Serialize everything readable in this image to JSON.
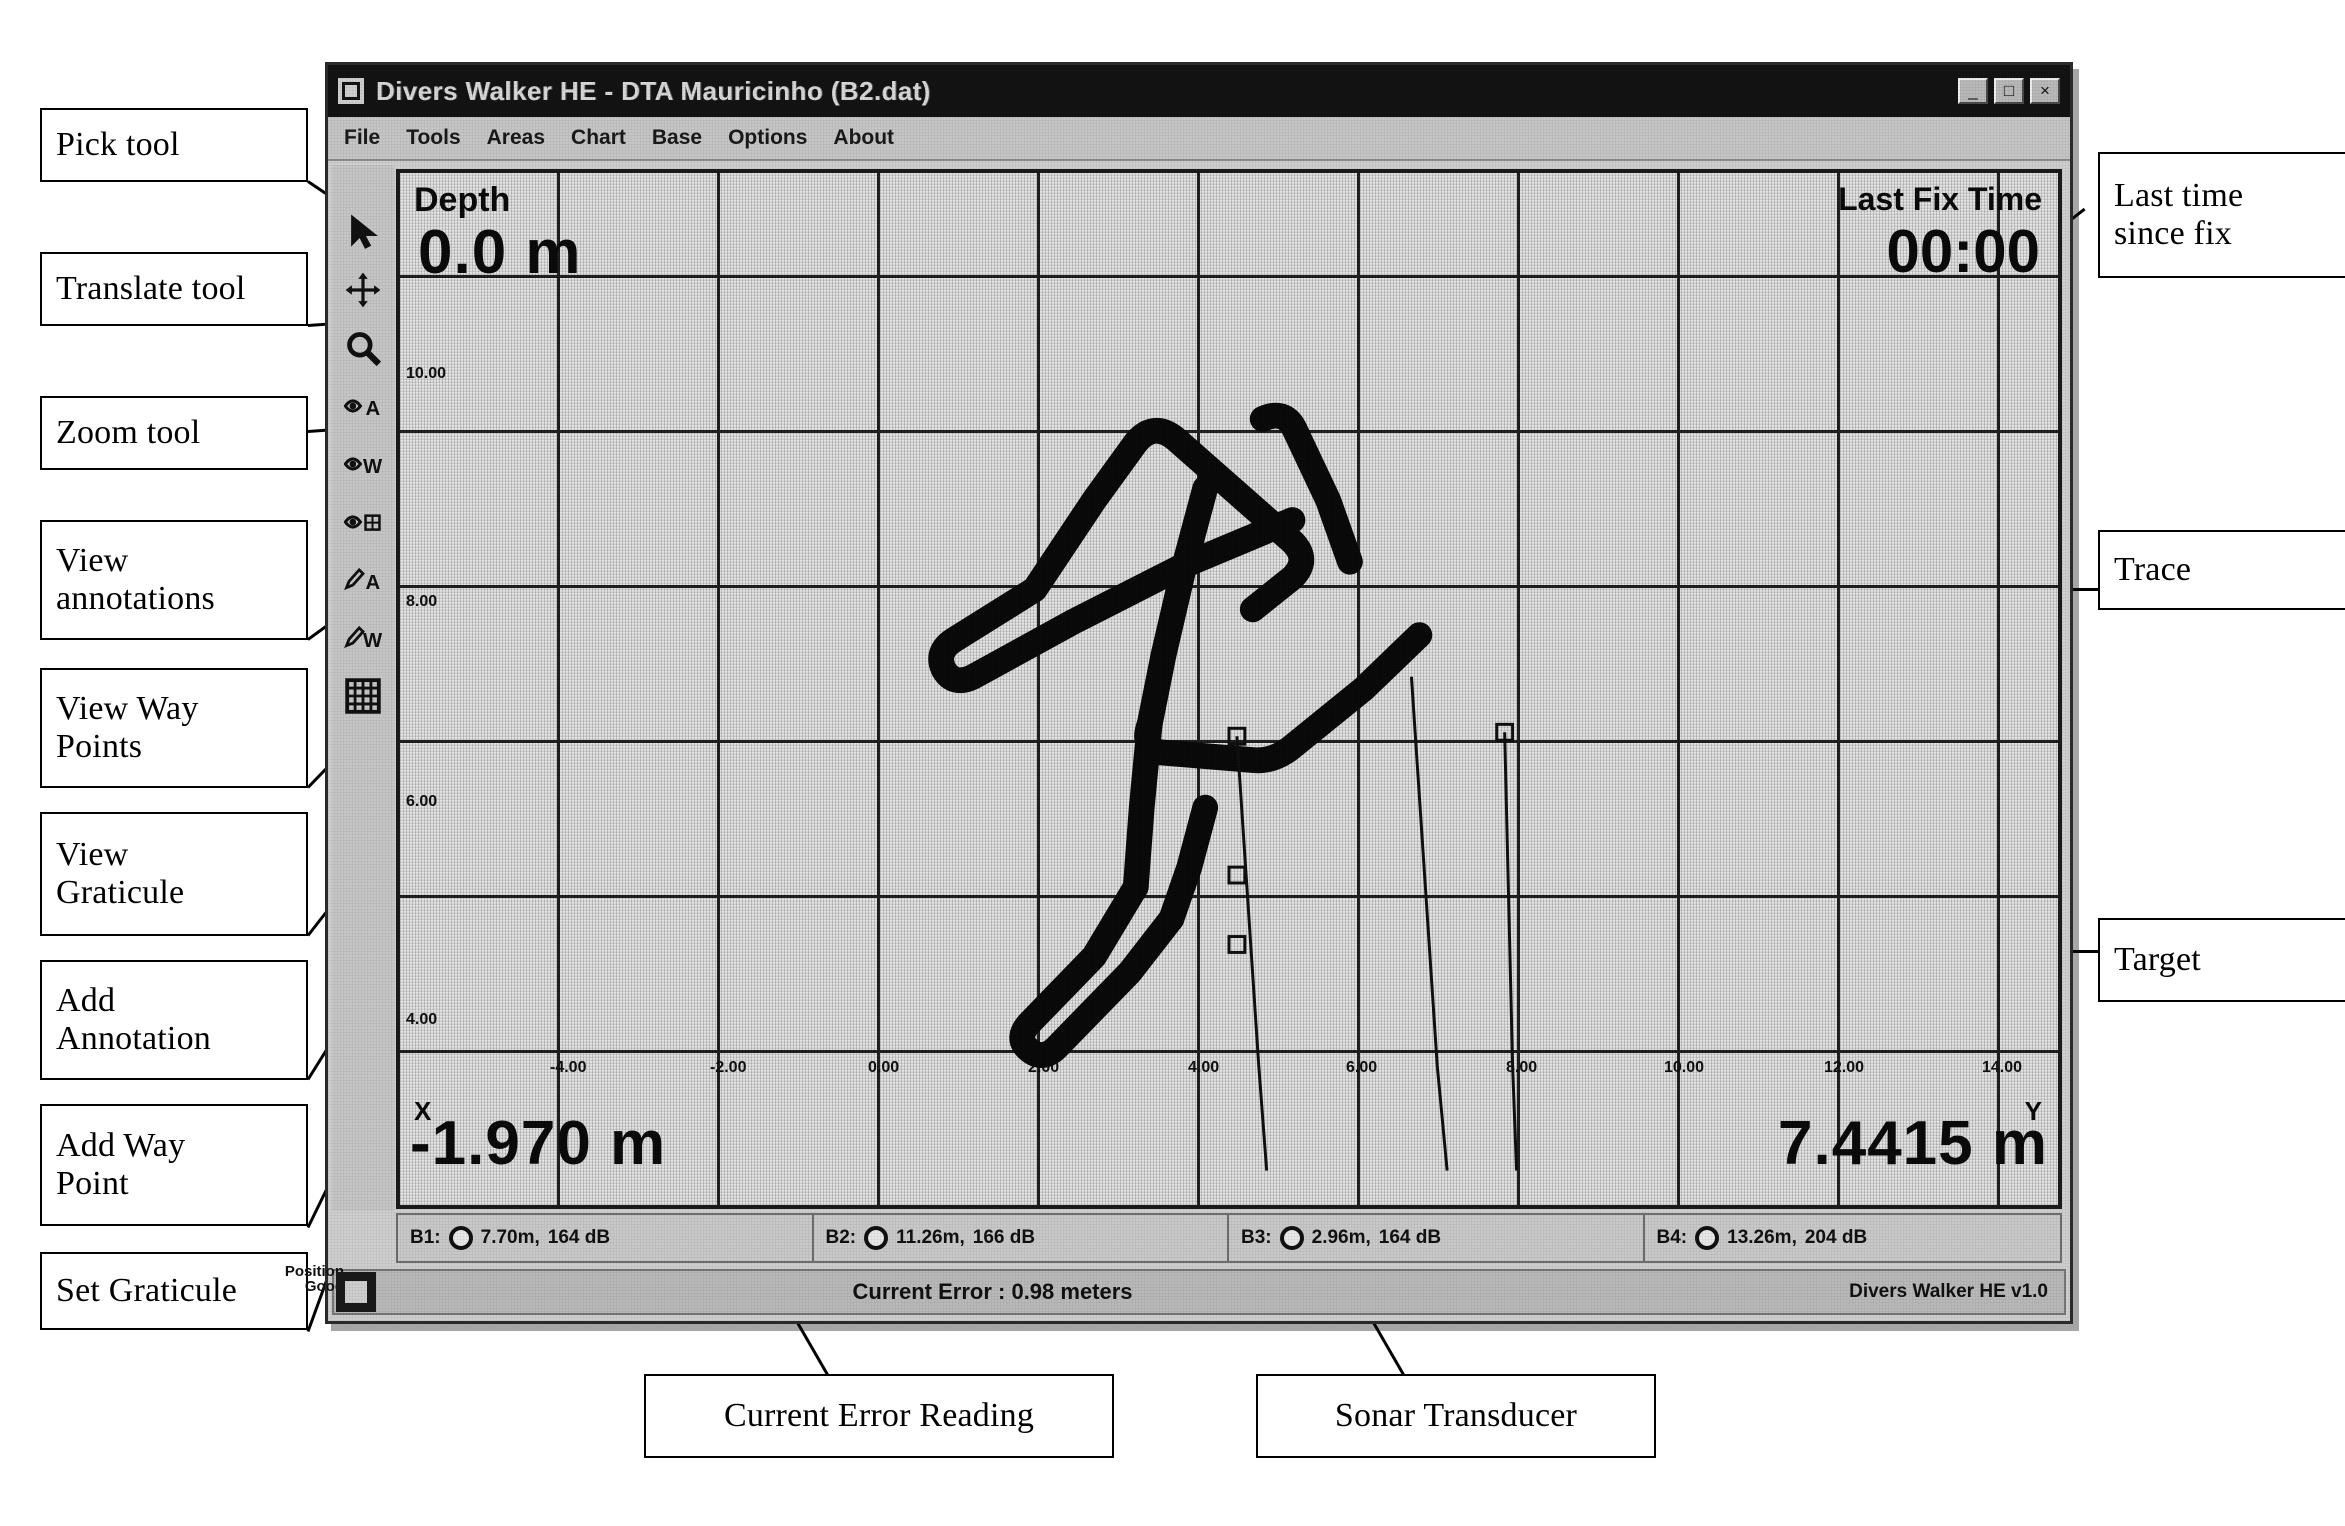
{
  "window": {
    "title": "Divers Walker HE - DTA Mauricinho (B2.dat)",
    "icon": "app-icon",
    "buttons": {
      "minimize": "_",
      "maximize": "□",
      "close": "×"
    }
  },
  "menu": {
    "items": [
      "File",
      "Tools",
      "Areas",
      "Chart",
      "Base",
      "Options",
      "About"
    ]
  },
  "toolbar": {
    "items": [
      {
        "name": "pick-tool",
        "icon": "cursor-arrow-icon",
        "label": "Pick tool"
      },
      {
        "name": "translate-tool",
        "icon": "move-cross-icon",
        "label": "Translate tool"
      },
      {
        "name": "zoom-tool",
        "icon": "magnifier-icon",
        "label": "Zoom tool"
      },
      {
        "name": "view-annotations",
        "icon": "eye-letter-a-icon",
        "label": "View annotations"
      },
      {
        "name": "view-way-points",
        "icon": "eye-letter-w-icon",
        "label": "View Way Points"
      },
      {
        "name": "view-graticule",
        "icon": "eye-grid-icon",
        "label": "View Graticule"
      },
      {
        "name": "add-annotation",
        "icon": "pencil-letter-a-icon",
        "label": "Add Annotation"
      },
      {
        "name": "add-way-point",
        "icon": "pencil-letter-w-icon",
        "label": "Add Way Point"
      },
      {
        "name": "set-graticule",
        "icon": "grid-icon",
        "label": "Set Graticule"
      }
    ]
  },
  "hud": {
    "depth_label": "Depth",
    "depth_value": "0.0 m",
    "last_fix_label": "Last Fix Time",
    "last_fix_value": "00:00",
    "x_label": "X",
    "x_value": "-1.970 m",
    "y_label": "Y",
    "y_value": "7.4415 m"
  },
  "graticule": {
    "y_ticks": [
      "10.00",
      "8.00",
      "6.00",
      "4.00"
    ],
    "x_ticks": [
      "-4.00",
      "-2.00",
      "0.00",
      "2.00",
      "4.00",
      "6.00",
      "8.00",
      "10.00",
      "12.00",
      "14.00"
    ]
  },
  "beacons": [
    {
      "id": "B1:",
      "range": "7.70m,",
      "level": "164 dB"
    },
    {
      "id": "B2:",
      "range": "11.26m,",
      "level": "166 dB"
    },
    {
      "id": "B3:",
      "range": "2.96m,",
      "level": "164 dB"
    },
    {
      "id": "B4:",
      "range": "13.26m,",
      "level": "204 dB"
    }
  ],
  "status": {
    "position_quality": "Position\nGood",
    "led": "status-led",
    "error_text": "Current Error : 0.98 meters",
    "right_text": "Divers Walker  HE  v1.0"
  },
  "callouts": {
    "left": [
      {
        "name": "callout-pick-tool",
        "text": "Pick tool"
      },
      {
        "name": "callout-translate-tool",
        "text": "Translate tool"
      },
      {
        "name": "callout-zoom-tool",
        "text": "Zoom tool"
      },
      {
        "name": "callout-view-annotations",
        "line1": "View",
        "line2": "annotations"
      },
      {
        "name": "callout-view-way-points",
        "line1": "View Way",
        "line2": "Points"
      },
      {
        "name": "callout-view-graticule",
        "line1": "View",
        "line2": "Graticule"
      },
      {
        "name": "callout-add-annotation",
        "line1": "Add",
        "line2": "Annotation"
      },
      {
        "name": "callout-add-way-point",
        "line1": "Add Way",
        "line2": "Point"
      },
      {
        "name": "callout-set-graticule",
        "text": "Set Graticule"
      }
    ],
    "right": [
      {
        "name": "callout-last-time-since-fix",
        "line1": "Last time",
        "line2": "since fix"
      },
      {
        "name": "callout-trace",
        "text": "Trace"
      },
      {
        "name": "callout-target",
        "text": "Target"
      }
    ],
    "bottom": [
      {
        "name": "callout-current-error-reading",
        "text": "Current Error Reading"
      },
      {
        "name": "callout-sonar-transducer",
        "text": "Sonar Transducer"
      }
    ]
  },
  "colors": {
    "window_chrome": "#c6c6c6",
    "title_bar": "#131313",
    "chart_bg": "#e4e4e4",
    "grid_line": "#222222",
    "trace": "#0a0a0a",
    "outline": "#000000"
  }
}
